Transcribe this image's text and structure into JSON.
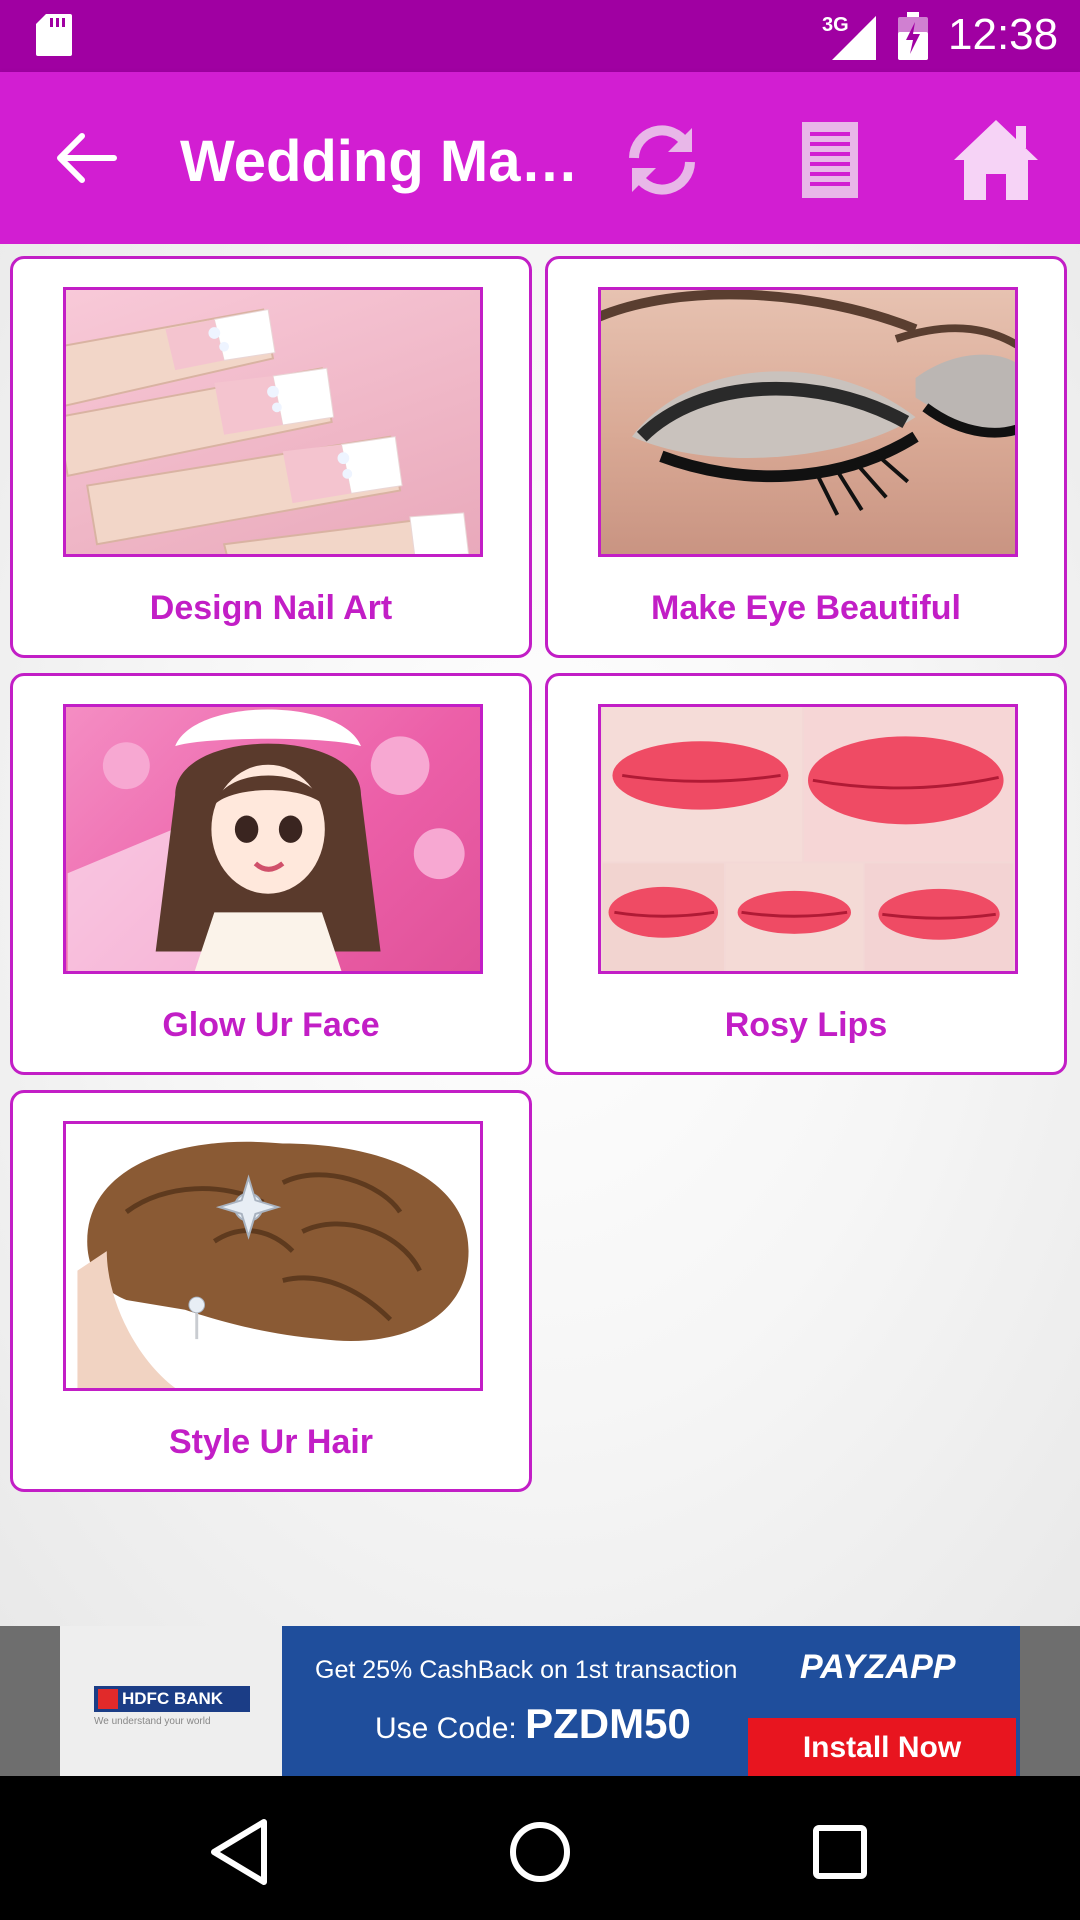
{
  "status_bar": {
    "network": "3G",
    "time": "12:38",
    "icons": [
      "sd-card-icon",
      "signal-icon",
      "battery-icon"
    ]
  },
  "app_bar": {
    "title": "Wedding Ma…",
    "color": "#d21ed2",
    "icons": [
      "back-arrow-icon",
      "refresh-icon",
      "list-icon",
      "home-icon"
    ]
  },
  "cards": [
    {
      "label": "Design Nail Art",
      "icon": "nail-art-image"
    },
    {
      "label": "Make Eye Beautiful",
      "icon": "eye-makeup-image"
    },
    {
      "label": "Glow Ur Face",
      "icon": "bride-face-image"
    },
    {
      "label": "Rosy Lips",
      "icon": "lips-image"
    },
    {
      "label": "Style Ur Hair",
      "icon": "hairstyle-image"
    }
  ],
  "ad": {
    "bank": "HDFC BANK",
    "bank_tagline": "We understand your world",
    "line1": "Get 25% CashBack on 1st transaction",
    "code_prefix": "Use Code:",
    "code": "PZDM50",
    "brand": "PAYZAPP",
    "cta": "Install Now"
  },
  "nav_bar": {
    "icons": [
      "back-triangle-icon",
      "home-circle-icon",
      "recents-square-icon"
    ]
  },
  "colors": {
    "status_bar": "#a000a2",
    "accent": "#c21ec6"
  }
}
